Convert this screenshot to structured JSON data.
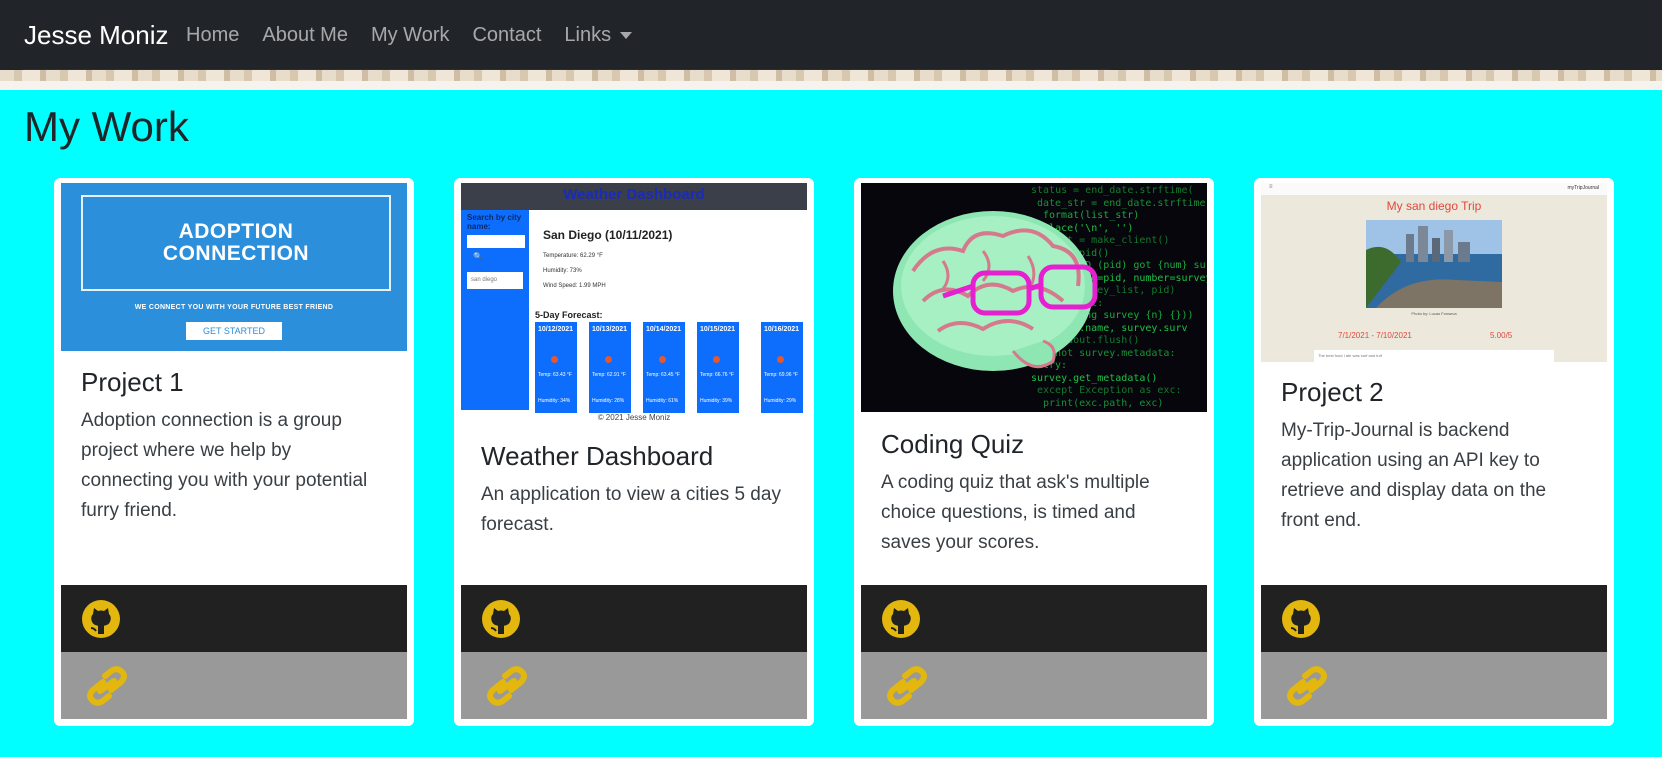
{
  "navbar": {
    "brand": "Jesse Moniz",
    "links": [
      "Home",
      "About Me",
      "My Work",
      "Contact",
      "Links"
    ]
  },
  "section": {
    "title": "My Work"
  },
  "colors": {
    "section_bg": "#00ffff",
    "navbar_bg": "#212529",
    "icon_gold": "#e3b70d"
  },
  "cards": [
    {
      "title": "Project 1",
      "text": "Adoption connection is a group project where we help by connecting you with your potential furry friend.",
      "image": {
        "line1": "ADOPTION",
        "line2": "CONNECTION",
        "tagline": "WE CONNECT YOU WITH YOUR FUTURE BEST FRIEND",
        "button": "GET STARTED"
      }
    },
    {
      "title": "Weather Dashboard",
      "text": "An application to view a cities 5 day forecast.",
      "image": {
        "header": "Weather Dashboard",
        "search_label": "Search by city name:",
        "history": "san diego",
        "city": "San Diego (10/11/2021)",
        "temperature": "Temperature: 62.29 °F",
        "humidity": "Humidity: 73%",
        "wind": "Wind Speed: 1.99 MPH",
        "forecast_label": "5-Day Forecast:",
        "days": [
          {
            "date": "10/12/2021",
            "temp": "Temp: 63.43 °F",
            "hum": "Humidity: 34%"
          },
          {
            "date": "10/13/2021",
            "temp": "Temp: 62.91 °F",
            "hum": "Humidity: 28%"
          },
          {
            "date": "10/14/2021",
            "temp": "Temp: 63.45 °F",
            "hum": "Humidity: 61%"
          },
          {
            "date": "10/15/2021",
            "temp": "Temp: 66.76 °F",
            "hum": "Humidity: 39%"
          },
          {
            "date": "10/16/2021",
            "temp": "Temp: 69.96 °F",
            "hum": "Humidity: 29%"
          }
        ],
        "footer": "© 2021 Jesse Moniz"
      }
    },
    {
      "title": "Coding Quiz",
      "text": "A coding quiz that ask's multiple choice questions, is timed and saves your scores.",
      "image": {
        "code_lines": [
          "status = end_date.strftime(",
          "date_str = end_date.strftime(",
          "format(list_str)",
          "replace('\\n', '')",
          "client = make_client()",
          "os.getpid()",
          "Process ID (pid) got {num} survey",
          "format(pid=pid, number=survey",
          "info(survey_list, pid)",
          "survey_list:",
          "Processing survey {n} {}))",
          "survey.name, survey.surv",
          "sys.stdout.flush()",
          "if not survey.metadata:",
          "try:",
          "survey.get_metadata()",
          "except Exception as exc:",
          "print(exc.path, exc)"
        ]
      }
    },
    {
      "title": "Project 2",
      "text": "My-Trip-Journal is backend application using an API key to retrieve and display data on the front end.",
      "image": {
        "app_name": "myTripJournal",
        "trip_title": "My san diego Trip",
        "caption": "Photo by: Lucas Fonseca",
        "dates": "7/1/2021 - 7/10/2021",
        "score": "5.00/5",
        "journal": "The best food I ate was surf and turf"
      }
    }
  ]
}
